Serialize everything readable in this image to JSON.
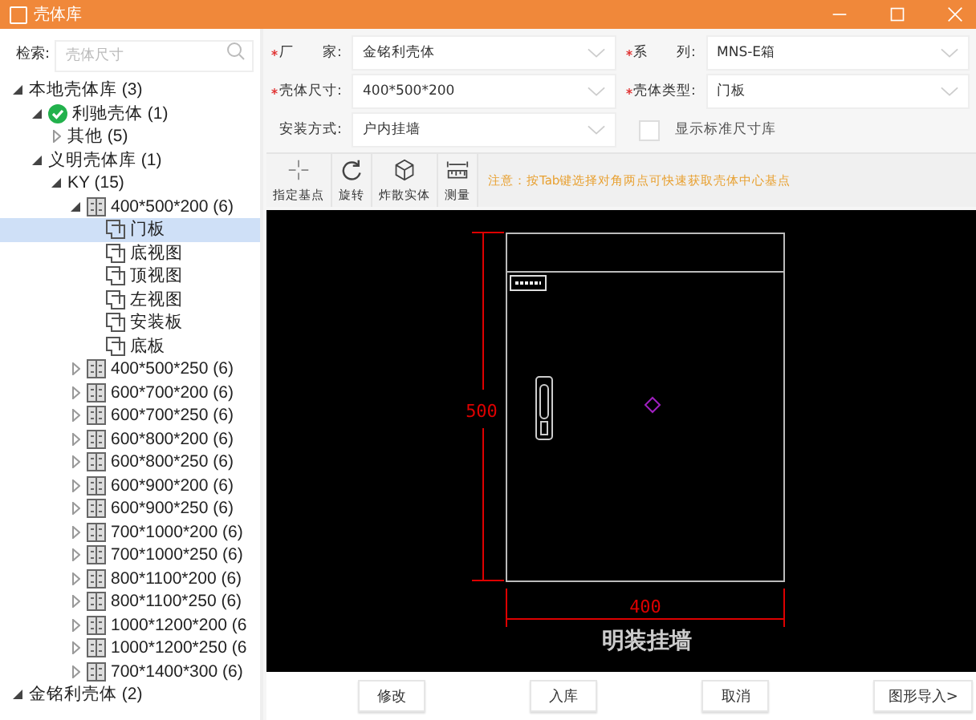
{
  "window": {
    "title": "壳体库"
  },
  "search": {
    "label": "检索:",
    "placeholder": "壳体尺寸"
  },
  "tree": [
    {
      "label": "本地壳体库 (3)",
      "expanded": true,
      "selected": false,
      "children": [
        {
          "label": "利驰壳体 (1)",
          "kind": "verified-vendor",
          "expanded": true,
          "selected": false,
          "children": [
            {
              "label": "其他 (5)",
              "expanded": false,
              "selected": false
            }
          ]
        },
        {
          "label": "义明壳体库 (1)",
          "expanded": true,
          "selected": false,
          "children": [
            {
              "label": "KY (15)",
              "expanded": true,
              "selected": false,
              "children": [
                {
                  "label": "400*500*200 (6)",
                  "kind": "size",
                  "expanded": true,
                  "selected": false,
                  "children": [
                    {
                      "label": "门板",
                      "kind": "view",
                      "selected": true
                    },
                    {
                      "label": "底视图",
                      "kind": "view",
                      "selected": false
                    },
                    {
                      "label": "顶视图",
                      "kind": "view",
                      "selected": false
                    },
                    {
                      "label": "左视图",
                      "kind": "view",
                      "selected": false
                    },
                    {
                      "label": "安装板",
                      "kind": "view",
                      "selected": false
                    },
                    {
                      "label": "底板",
                      "kind": "view",
                      "selected": false
                    }
                  ]
                },
                {
                  "label": "400*500*250 (6)",
                  "kind": "size",
                  "expanded": false,
                  "selected": false
                },
                {
                  "label": "600*700*200 (6)",
                  "kind": "size",
                  "expanded": false,
                  "selected": false
                },
                {
                  "label": "600*700*250 (6)",
                  "kind": "size",
                  "expanded": false,
                  "selected": false
                },
                {
                  "label": "600*800*200 (6)",
                  "kind": "size",
                  "expanded": false,
                  "selected": false
                },
                {
                  "label": "600*800*250 (6)",
                  "kind": "size",
                  "expanded": false,
                  "selected": false
                },
                {
                  "label": "600*900*200 (6)",
                  "kind": "size",
                  "expanded": false,
                  "selected": false
                },
                {
                  "label": "600*900*250 (6)",
                  "kind": "size",
                  "expanded": false,
                  "selected": false
                },
                {
                  "label": "700*1000*200 (6)",
                  "kind": "size",
                  "expanded": false,
                  "selected": false
                },
                {
                  "label": "700*1000*250 (6)",
                  "kind": "size",
                  "expanded": false,
                  "selected": false
                },
                {
                  "label": "800*1100*200 (6)",
                  "kind": "size",
                  "expanded": false,
                  "selected": false
                },
                {
                  "label": "800*1100*250 (6)",
                  "kind": "size",
                  "expanded": false,
                  "selected": false
                },
                {
                  "label": "1000*1200*200 (6",
                  "kind": "size",
                  "expanded": false,
                  "selected": false
                },
                {
                  "label": "1000*1200*250 (6",
                  "kind": "size",
                  "expanded": false,
                  "selected": false
                },
                {
                  "label": "700*1400*300 (6)",
                  "kind": "size",
                  "expanded": false,
                  "selected": false
                }
              ]
            }
          ]
        }
      ]
    },
    {
      "label": "金铭利壳体 (2)",
      "expanded": true,
      "selected": false
    }
  ],
  "form": [
    {
      "label": "厂　　家:",
      "required": true,
      "kind": "dropdown",
      "value": "金铭利壳体"
    },
    {
      "label": "系　　列:",
      "required": true,
      "kind": "dropdown",
      "value": "MNS-E箱"
    },
    {
      "label": "壳体尺寸:",
      "required": true,
      "kind": "dropdown",
      "value": "400*500*200"
    },
    {
      "label": "壳体类型:",
      "required": true,
      "kind": "dropdown",
      "value": "门板"
    },
    {
      "label": "安装方式:",
      "required": false,
      "kind": "dropdown",
      "value": "户内挂墙"
    },
    {
      "label": "显示标准尺寸库",
      "kind": "checkbox",
      "checked": false
    }
  ],
  "toolbar": [
    {
      "label": "指定基点",
      "kind": "crosshair"
    },
    {
      "label": "旋转",
      "kind": "rotate"
    },
    {
      "label": "炸散实体",
      "kind": "cube"
    },
    {
      "label": "测量",
      "kind": "ruler"
    }
  ],
  "notice": "注意：按Tab键选择对角两点可快速获取壳体中心基点",
  "drawing": {
    "height_label": "500",
    "width_label": "400",
    "caption": "明装挂墙"
  },
  "buttons": [
    "修改",
    "入库",
    "取消",
    "图形导入>"
  ]
}
